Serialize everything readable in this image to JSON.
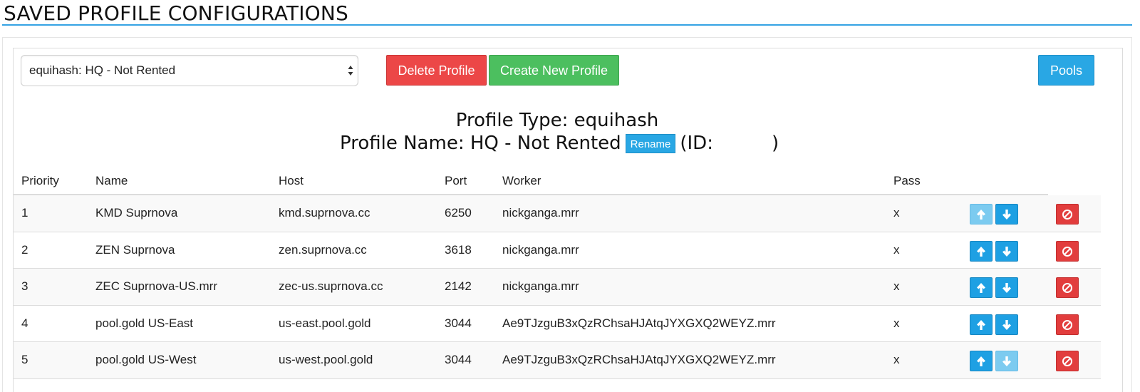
{
  "page": {
    "title": "SAVED PROFILE CONFIGURATIONS"
  },
  "toolbar": {
    "profile_select_value": "equihash: HQ - Not Rented",
    "delete_label": "Delete Profile",
    "create_label": "Create New Profile",
    "pools_label": "Pools"
  },
  "profile": {
    "type_line": "Profile Type: equihash",
    "name_line": "Profile Name: HQ - Not Rented",
    "rename_label": "Rename",
    "id_prefix": "(ID:",
    "id_suffix": ")"
  },
  "table": {
    "headers": {
      "priority": "Priority",
      "name": "Name",
      "host": "Host",
      "port": "Port",
      "worker": "Worker",
      "pass": "Pass"
    },
    "rows": [
      {
        "priority": "1",
        "name": "KMD Suprnova",
        "host": "kmd.suprnova.cc",
        "port": "6250",
        "worker": "nickganga.mrr",
        "pass": "x",
        "up_enabled": false,
        "down_enabled": true
      },
      {
        "priority": "2",
        "name": "ZEN Suprnova",
        "host": "zen.suprnova.cc",
        "port": "3618",
        "worker": "nickganga.mrr",
        "pass": "x",
        "up_enabled": true,
        "down_enabled": true
      },
      {
        "priority": "3",
        "name": "ZEC Suprnova-US.mrr",
        "host": "zec-us.suprnova.cc",
        "port": "2142",
        "worker": "nickganga.mrr",
        "pass": "x",
        "up_enabled": true,
        "down_enabled": true
      },
      {
        "priority": "4",
        "name": "pool.gold US-East",
        "host": "us-east.pool.gold",
        "port": "3044",
        "worker": "Ae9TJzguB3xQzRChsaHJAtqJYXGXQ2WEYZ.mrr",
        "pass": "x",
        "up_enabled": true,
        "down_enabled": true
      },
      {
        "priority": "5",
        "name": "pool.gold US-West",
        "host": "us-west.pool.gold",
        "port": "3044",
        "worker": "Ae9TJzguB3xQzRChsaHJAtqJYXGXQ2WEYZ.mrr",
        "pass": "x",
        "up_enabled": true,
        "down_enabled": false
      }
    ]
  },
  "icons": {
    "up": "arrow-up-icon",
    "down": "arrow-down-icon",
    "remove": "ban-icon",
    "select": "sort-arrows-icon"
  },
  "colors": {
    "accent_blue": "#29a7e4",
    "danger_red": "#ec4747",
    "success_green": "#4cbf5f",
    "disabled_blue": "#7ccbf0",
    "title_rule": "#35a3e4"
  }
}
